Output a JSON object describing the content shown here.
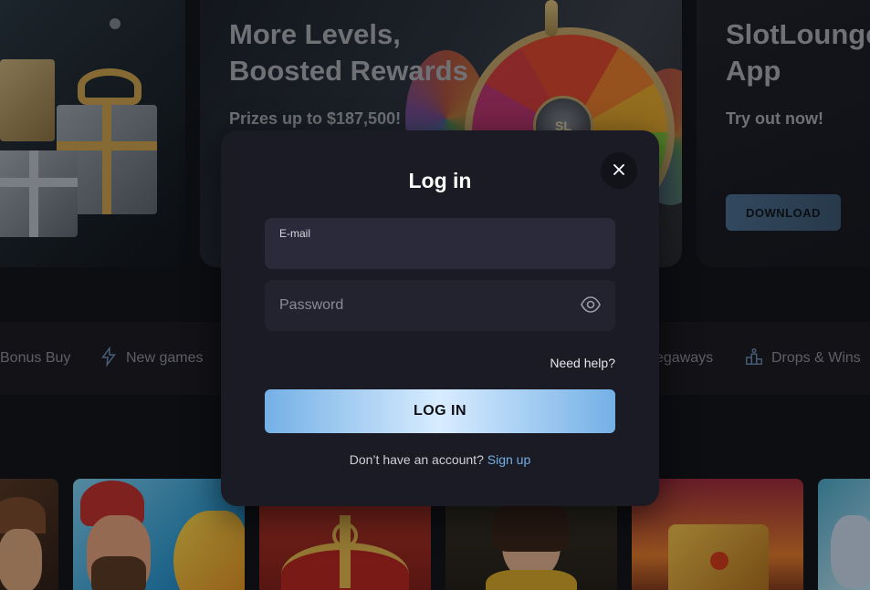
{
  "banners": {
    "levels": {
      "title_line1": "More Levels,",
      "title_line2": "Boosted Rewards",
      "subtitle": "Prizes up to $187,500!"
    },
    "app": {
      "title_line1": "SlotLounge",
      "title_line2": "App",
      "subtitle": "Try out now!",
      "button_label": "DOWNLOAD"
    },
    "wheel_hub_text": "SL"
  },
  "categories": [
    {
      "label": "Bonus Buy",
      "icon": "bonus-buy-icon"
    },
    {
      "label": "New games",
      "icon": "lightning-icon"
    },
    {
      "label": "egaways",
      "icon": "megaways-icon"
    },
    {
      "label": "Drops & Wins",
      "icon": "podium-icon"
    }
  ],
  "login_modal": {
    "title": "Log in",
    "close_icon": "close-icon",
    "email_label": "E-mail",
    "email_value": "",
    "password_placeholder": "Password",
    "password_icon": "eye-icon",
    "need_help": "Need help?",
    "login_button": "LOG IN",
    "no_account_text": "Don’t have an account?",
    "signup_link": "Sign up"
  },
  "colors": {
    "modal_bg": "#1a1b24",
    "login_gradient_edge": "#74b0e6",
    "login_gradient_center": "#d8ecff",
    "link": "#74aee3"
  }
}
